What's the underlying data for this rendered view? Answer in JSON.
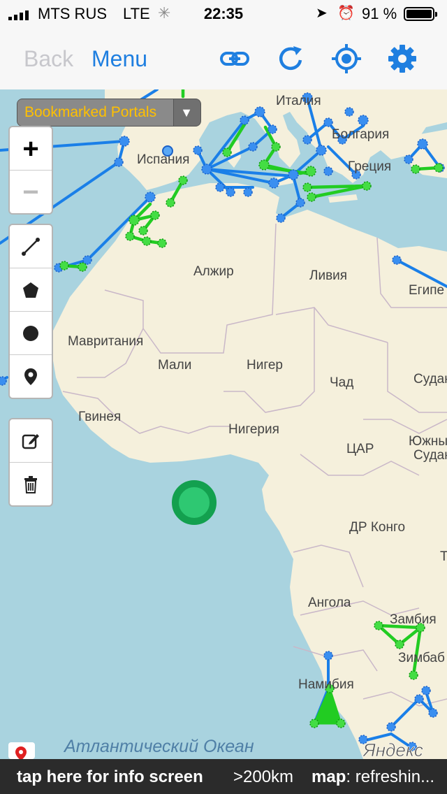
{
  "status_bar": {
    "carrier": "MTS RUS",
    "network": "LTE",
    "time": "22:35",
    "battery": "91 %"
  },
  "nav": {
    "back_label": "Back",
    "menu_label": "Menu",
    "icons": [
      "link-icon",
      "refresh-icon",
      "locate-icon",
      "settings-icon"
    ]
  },
  "bookmark": {
    "label": "Bookmarked Portals",
    "arrow": "▼"
  },
  "map_labels": {
    "italy": "Италия",
    "bulgaria": "Болгария",
    "spain": "Испания",
    "greece": "Греция",
    "algeria": "Алжир",
    "libya": "Ливия",
    "egypt": "Египе",
    "mauritania": "Мавритания",
    "mali": "Мали",
    "niger": "Нигер",
    "chad": "Чад",
    "sudan": "Судан",
    "guinea": "Гвинея",
    "nigeria": "Нигерия",
    "car": "ЦАР",
    "south_sudan_1": "Южны",
    "south_sudan_2": "Судан",
    "drc": "ДР Конго",
    "angola": "Ангола",
    "zambia": "Замбия",
    "zimbabwe": "Зимбаб",
    "namibia": "Намибия",
    "atlantic": "Атлантический Океан",
    "yandex": "Яндекс",
    "t_fragment": "Т"
  },
  "bottom_bar": {
    "info": "tap here for info screen",
    "distance": ">200km",
    "map_key": "map",
    "map_status": ": refreshin..."
  },
  "colors": {
    "accent": "#1f7fe0",
    "link_blue": "#1a7fe8",
    "link_green": "#22cc22",
    "land": "#f5f0dc",
    "water": "#a9d3df",
    "bookmark_text": "#ffc000"
  }
}
